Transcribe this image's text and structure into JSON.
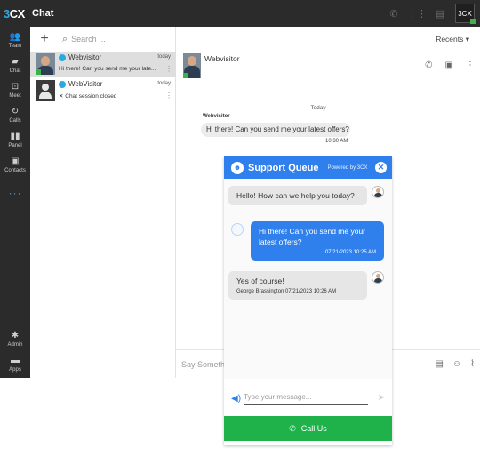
{
  "topbar": {
    "logo": "CX",
    "logo_prefix": "3",
    "title": "Chat",
    "user_badge": "3CX"
  },
  "sidebar": {
    "items": [
      {
        "label": "Team",
        "glyph": "👥"
      },
      {
        "label": "Chat",
        "glyph": "▰"
      },
      {
        "label": "Meet",
        "glyph": "⊡"
      },
      {
        "label": "Calls",
        "glyph": "↻"
      },
      {
        "label": "Panel",
        "glyph": "▮▮"
      },
      {
        "label": "Contacts",
        "glyph": "▣"
      }
    ],
    "more": "···",
    "bottom_items": [
      {
        "label": "Admin",
        "glyph": "✱"
      },
      {
        "label": "Apps",
        "glyph": "▬"
      }
    ]
  },
  "list": {
    "add_label": "+",
    "search_placeholder": "Search ...",
    "conversations": [
      {
        "name": "Webvisitor",
        "when": "today",
        "preview": "Hi there! Can you send me your late..."
      },
      {
        "name": "WebVisitor",
        "when": "today",
        "preview": "✕ Chat session closed"
      }
    ]
  },
  "chat": {
    "filter": "Recents ▾",
    "contact_name": "Webvisitor",
    "day": "Today",
    "sender": "Webvisitor",
    "message": "Hi there! Can you send me your latest offers?",
    "time": "10:30 AM",
    "composer_placeholder": "Say Someth"
  },
  "widget": {
    "title": "Support Queue",
    "powered": "Powered by 3CX",
    "messages": [
      {
        "from": "agent",
        "text": "Hello! How can we help you today?",
        "meta": ""
      },
      {
        "from": "visitor",
        "text": "Hi there! Can you send me your latest offers?",
        "meta": "07/21/2023 10:25 AM"
      },
      {
        "from": "agent",
        "text": "Yes of course!",
        "meta": "George Brassington 07/21/2023 10:26 AM"
      }
    ],
    "input_placeholder": "Type your message...",
    "call_label": "Call Us"
  },
  "colors": {
    "dark_bar": "#2b2b2b",
    "accent_blue": "#2f80ed",
    "call_green": "#1fb14a",
    "presence_green": "#3bb34a"
  }
}
